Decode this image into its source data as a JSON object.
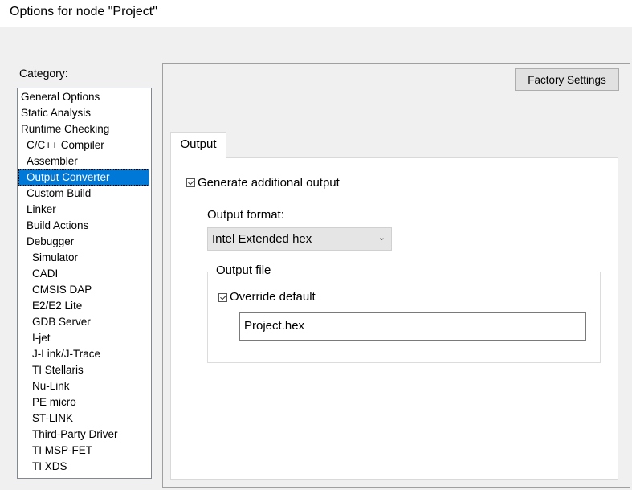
{
  "window": {
    "title": "Options for node \"Project\""
  },
  "category": {
    "label": "Category:",
    "items": [
      {
        "label": "General Options",
        "indent": 0
      },
      {
        "label": "Static Analysis",
        "indent": 0
      },
      {
        "label": "Runtime Checking",
        "indent": 0
      },
      {
        "label": "C/C++ Compiler",
        "indent": 1
      },
      {
        "label": "Assembler",
        "indent": 1
      },
      {
        "label": "Output Converter",
        "indent": 1,
        "selected": true
      },
      {
        "label": "Custom Build",
        "indent": 1
      },
      {
        "label": "Linker",
        "indent": 1
      },
      {
        "label": "Build Actions",
        "indent": 1
      },
      {
        "label": "Debugger",
        "indent": 1
      },
      {
        "label": "Simulator",
        "indent": 2
      },
      {
        "label": "CADI",
        "indent": 2
      },
      {
        "label": "CMSIS DAP",
        "indent": 2
      },
      {
        "label": "E2/E2 Lite",
        "indent": 2
      },
      {
        "label": "GDB Server",
        "indent": 2
      },
      {
        "label": "I-jet",
        "indent": 2
      },
      {
        "label": "J-Link/J-Trace",
        "indent": 2
      },
      {
        "label": "TI Stellaris",
        "indent": 2
      },
      {
        "label": "Nu-Link",
        "indent": 2
      },
      {
        "label": "PE micro",
        "indent": 2
      },
      {
        "label": "ST-LINK",
        "indent": 2
      },
      {
        "label": "Third-Party Driver",
        "indent": 2
      },
      {
        "label": "TI MSP-FET",
        "indent": 2
      },
      {
        "label": "TI XDS",
        "indent": 2
      }
    ]
  },
  "toolbar": {
    "factory_settings_label": "Factory Settings"
  },
  "tabs": [
    {
      "label": "Output"
    }
  ],
  "output": {
    "generate_label": "Generate additional output",
    "generate_checked": true,
    "format_label": "Output format:",
    "format_value": "Intel Extended hex",
    "file_group_title": "Output file",
    "override_label": "Override default",
    "override_checked": true,
    "filename_value": "Project.hex"
  }
}
